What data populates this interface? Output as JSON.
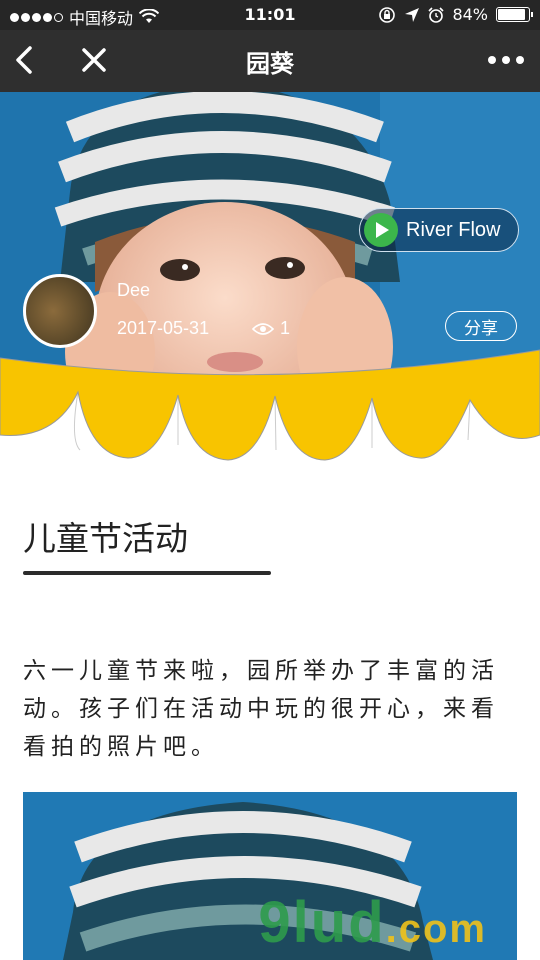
{
  "status_bar": {
    "carrier": "中国移动",
    "time": "11:01",
    "battery": "84%",
    "battery_level": 0.84
  },
  "nav": {
    "title": "园葵",
    "back_icon": "chevron-left-icon",
    "close_icon": "close-icon",
    "more_icon": "more-dots-icon"
  },
  "cover": {
    "music_label": "River Flow",
    "author": "Dee",
    "date": "2017-05-31",
    "views": "1",
    "share_label": "分享",
    "scallop_color": "#f8c400"
  },
  "article": {
    "title": "儿童节活动",
    "body": "六一儿童节来啦，园所举办了丰富的活动。孩子们在活动中玩的很开心，来看看拍的照片吧。"
  },
  "watermark": {
    "text_main": "9lud",
    "text_suffix": ".com"
  }
}
